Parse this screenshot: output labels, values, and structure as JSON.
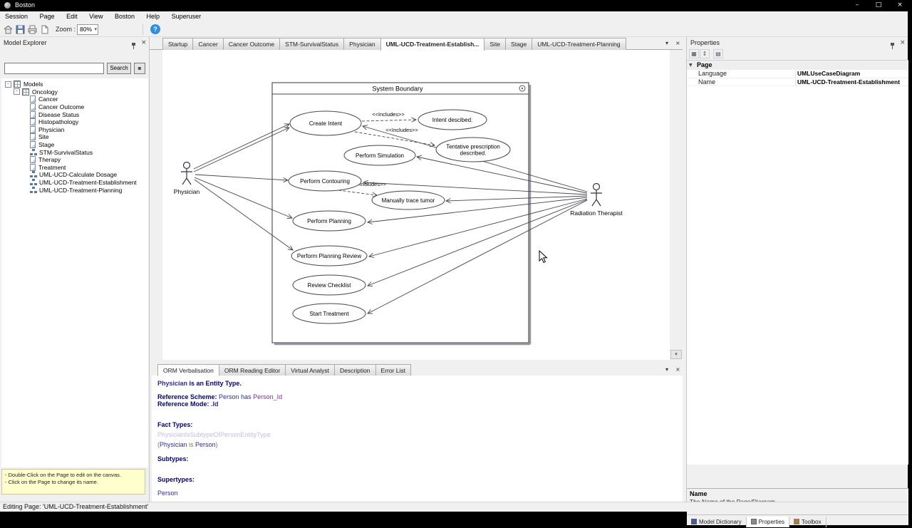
{
  "window": {
    "title": "Boston"
  },
  "icons": {
    "minimize": "–",
    "maximize": "□",
    "close": "×",
    "chevron_down": "▾",
    "close_small": "×",
    "help": "?",
    "collapse": "-",
    "scroll_down": "▾",
    "category_expand": "▼",
    "toolbar_categorized": "▦",
    "toolbar_sort": "↕",
    "toolbar_pages": "▤",
    "search_extra": "▪"
  },
  "menu": {
    "items": [
      "Session",
      "Page",
      "Edit",
      "View",
      "Boston",
      "Help",
      "Superuser"
    ]
  },
  "toolbar": {
    "zoom_label": "Zoom :",
    "zoom_value": "80%"
  },
  "explorer": {
    "title": "Model Explorer",
    "search_button": "Search",
    "tree": [
      {
        "label": "Models"
      },
      {
        "label": "Oncology"
      },
      {
        "label": "Cancer"
      },
      {
        "label": "Cancer Outcome"
      },
      {
        "label": "Disease Status"
      },
      {
        "label": "Histopathology"
      },
      {
        "label": "Physician"
      },
      {
        "label": "Site"
      },
      {
        "label": "Stage"
      },
      {
        "label": "STM-SurvivalStatus"
      },
      {
        "label": "Therapy"
      },
      {
        "label": "Treatment"
      },
      {
        "label": "UML-UCD-Calculate Dosage"
      },
      {
        "label": "UML-UCD-Treatment-Establishment"
      },
      {
        "label": "UML-UCD-Treatment-Planning"
      }
    ],
    "note": {
      "line1": "- Double-Click on the Page to edit on the canvas.",
      "line2": "- Click on the Page to change its name."
    }
  },
  "doc_tabs": {
    "list": [
      {
        "label": "Startup"
      },
      {
        "label": "Cancer"
      },
      {
        "label": "Cancer Outcome"
      },
      {
        "label": "STM-SurvivalStatus"
      },
      {
        "label": "Physician"
      },
      {
        "label": "UML-UCD-Treatment-Establish..."
      },
      {
        "label": "Site"
      },
      {
        "label": "Stage"
      },
      {
        "label": "UML-UCD-Treatment-Planning"
      }
    ]
  },
  "canvas": {
    "boundary_title": "System Boundary",
    "actors": [
      {
        "label": "Physician"
      },
      {
        "label": "Radiation Therapist"
      }
    ],
    "nodes": [
      {
        "label": "Create Intent"
      },
      {
        "label": "Intent descibed."
      },
      {
        "label": "Tentative prescription",
        "label2": "described."
      },
      {
        "label": "Perform Simulation"
      },
      {
        "label": "Perform Contouring"
      },
      {
        "label": "Manually trace tumor"
      },
      {
        "label": "Perform Planning"
      },
      {
        "label": "Perform Planning Review"
      },
      {
        "label": "Review Checklist"
      },
      {
        "label": "Start Treatment"
      }
    ],
    "includes": [
      {
        "label": "<<Includes>>"
      },
      {
        "label": "<<Includes>>"
      },
      {
        "label": "<<Includes>>"
      }
    ]
  },
  "bottom_panel": {
    "tabs": [
      {
        "label": "ORM Verbalisation"
      },
      {
        "label": "ORM Reading Editor"
      },
      {
        "label": "Virtual Analyst"
      },
      {
        "label": "Description"
      },
      {
        "label": "Error List"
      }
    ],
    "verbalization": {
      "l1_name": "Physician ",
      "l1_rest": "is an Entity Type.",
      "l2_label": "Reference Scheme: ",
      "l2_a": "Person has ",
      "l2_b": "Person_Id",
      "l3_label": "Reference Mode: ",
      "l3_value": ".Id",
      "l4": "Fact Types:",
      "l5": "PhysicianIsSubtypeOfPersonEntityType",
      "l6_open": "(",
      "l6_name": "Physician",
      "l6_mid": " is ",
      "l6_name2": "Person",
      "l6_close": ")",
      "l7": "Subtypes:",
      "l8": "Supertypes:",
      "l9": "Person"
    }
  },
  "properties": {
    "title": "Properties",
    "category": "Page",
    "rows": [
      {
        "label": "Language",
        "value": "UMLUseCaseDiagram"
      },
      {
        "label": "Name",
        "value": "UML-UCD-Treatment-Establishment"
      }
    ],
    "description": {
      "title": "Name",
      "text": "The Name of the Page/Diagram."
    },
    "bottom_tabs": [
      {
        "label": "Model Dictionary"
      },
      {
        "label": "Properties"
      },
      {
        "label": "Toolbox"
      }
    ]
  },
  "status_bar": {
    "text": "Editing Page: 'UML-UCD-Treatment-Establishment'"
  }
}
